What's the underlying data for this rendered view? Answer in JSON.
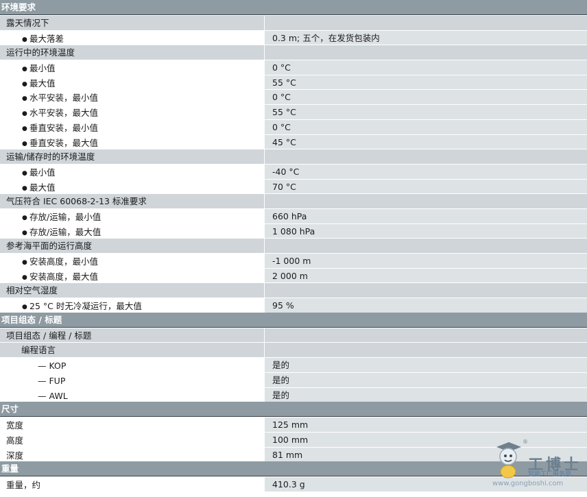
{
  "sections": [
    {
      "title": "环境要求",
      "rows": [
        {
          "kind": "group",
          "label": "露天情况下"
        },
        {
          "kind": "bullet",
          "label": "最大落差",
          "value": "0.3 m; 五个，在发货包装内"
        },
        {
          "kind": "group",
          "label": "运行中的环境温度"
        },
        {
          "kind": "bullet",
          "label": "最小值",
          "value": "0 °C"
        },
        {
          "kind": "bullet",
          "label": "最大值",
          "value": "55 °C"
        },
        {
          "kind": "bullet",
          "label": "水平安装，最小值",
          "value": "0 °C"
        },
        {
          "kind": "bullet",
          "label": "水平安装，最大值",
          "value": "55 °C"
        },
        {
          "kind": "bullet",
          "label": "垂直安装，最小值",
          "value": "0 °C"
        },
        {
          "kind": "bullet",
          "label": "垂直安装，最大值",
          "value": "45 °C"
        },
        {
          "kind": "group",
          "label": "运输/储存时的环境温度"
        },
        {
          "kind": "bullet",
          "label": "最小值",
          "value": "-40 °C"
        },
        {
          "kind": "bullet",
          "label": "最大值",
          "value": "70 °C"
        },
        {
          "kind": "group",
          "label": "气压符合 IEC 60068-2-13 标准要求"
        },
        {
          "kind": "bullet",
          "label": "存放/运输，最小值",
          "value": "660 hPa"
        },
        {
          "kind": "bullet",
          "label": "存放/运输，最大值",
          "value": "1 080 hPa"
        },
        {
          "kind": "group",
          "label": "参考海平面的运行高度"
        },
        {
          "kind": "bullet",
          "label": "安装高度，最小值",
          "value": "-1 000 m"
        },
        {
          "kind": "bullet",
          "label": "安装高度，最大值",
          "value": "2 000 m"
        },
        {
          "kind": "group",
          "label": "相对空气湿度"
        },
        {
          "kind": "bullet",
          "label": "25 °C 时无冷凝运行，最大值",
          "value": "95 %"
        }
      ]
    },
    {
      "title": "项目组态 / 标题",
      "rows": [
        {
          "kind": "group",
          "label": "项目组态 / 编程 / 标题"
        },
        {
          "kind": "subgroup",
          "label": "编程语言"
        },
        {
          "kind": "dash",
          "label": "— KOP",
          "value": "是的"
        },
        {
          "kind": "dash",
          "label": "— FUP",
          "value": "是的"
        },
        {
          "kind": "dash",
          "label": "— AWL",
          "value": "是的"
        }
      ]
    },
    {
      "title": "尺寸",
      "rows": [
        {
          "kind": "plain",
          "label": "宽度",
          "value": "125 mm"
        },
        {
          "kind": "plain",
          "label": "高度",
          "value": "100 mm"
        },
        {
          "kind": "plain",
          "label": "深度",
          "value": "81 mm"
        }
      ]
    },
    {
      "title": "重量",
      "rows": [
        {
          "kind": "plain",
          "label": "重量，约",
          "value": "410.3 g"
        }
      ]
    }
  ],
  "watermark": {
    "brand": "工博士",
    "registered": "®",
    "tagline": "智能工厂服务商",
    "url": "www.gongboshi.com"
  }
}
